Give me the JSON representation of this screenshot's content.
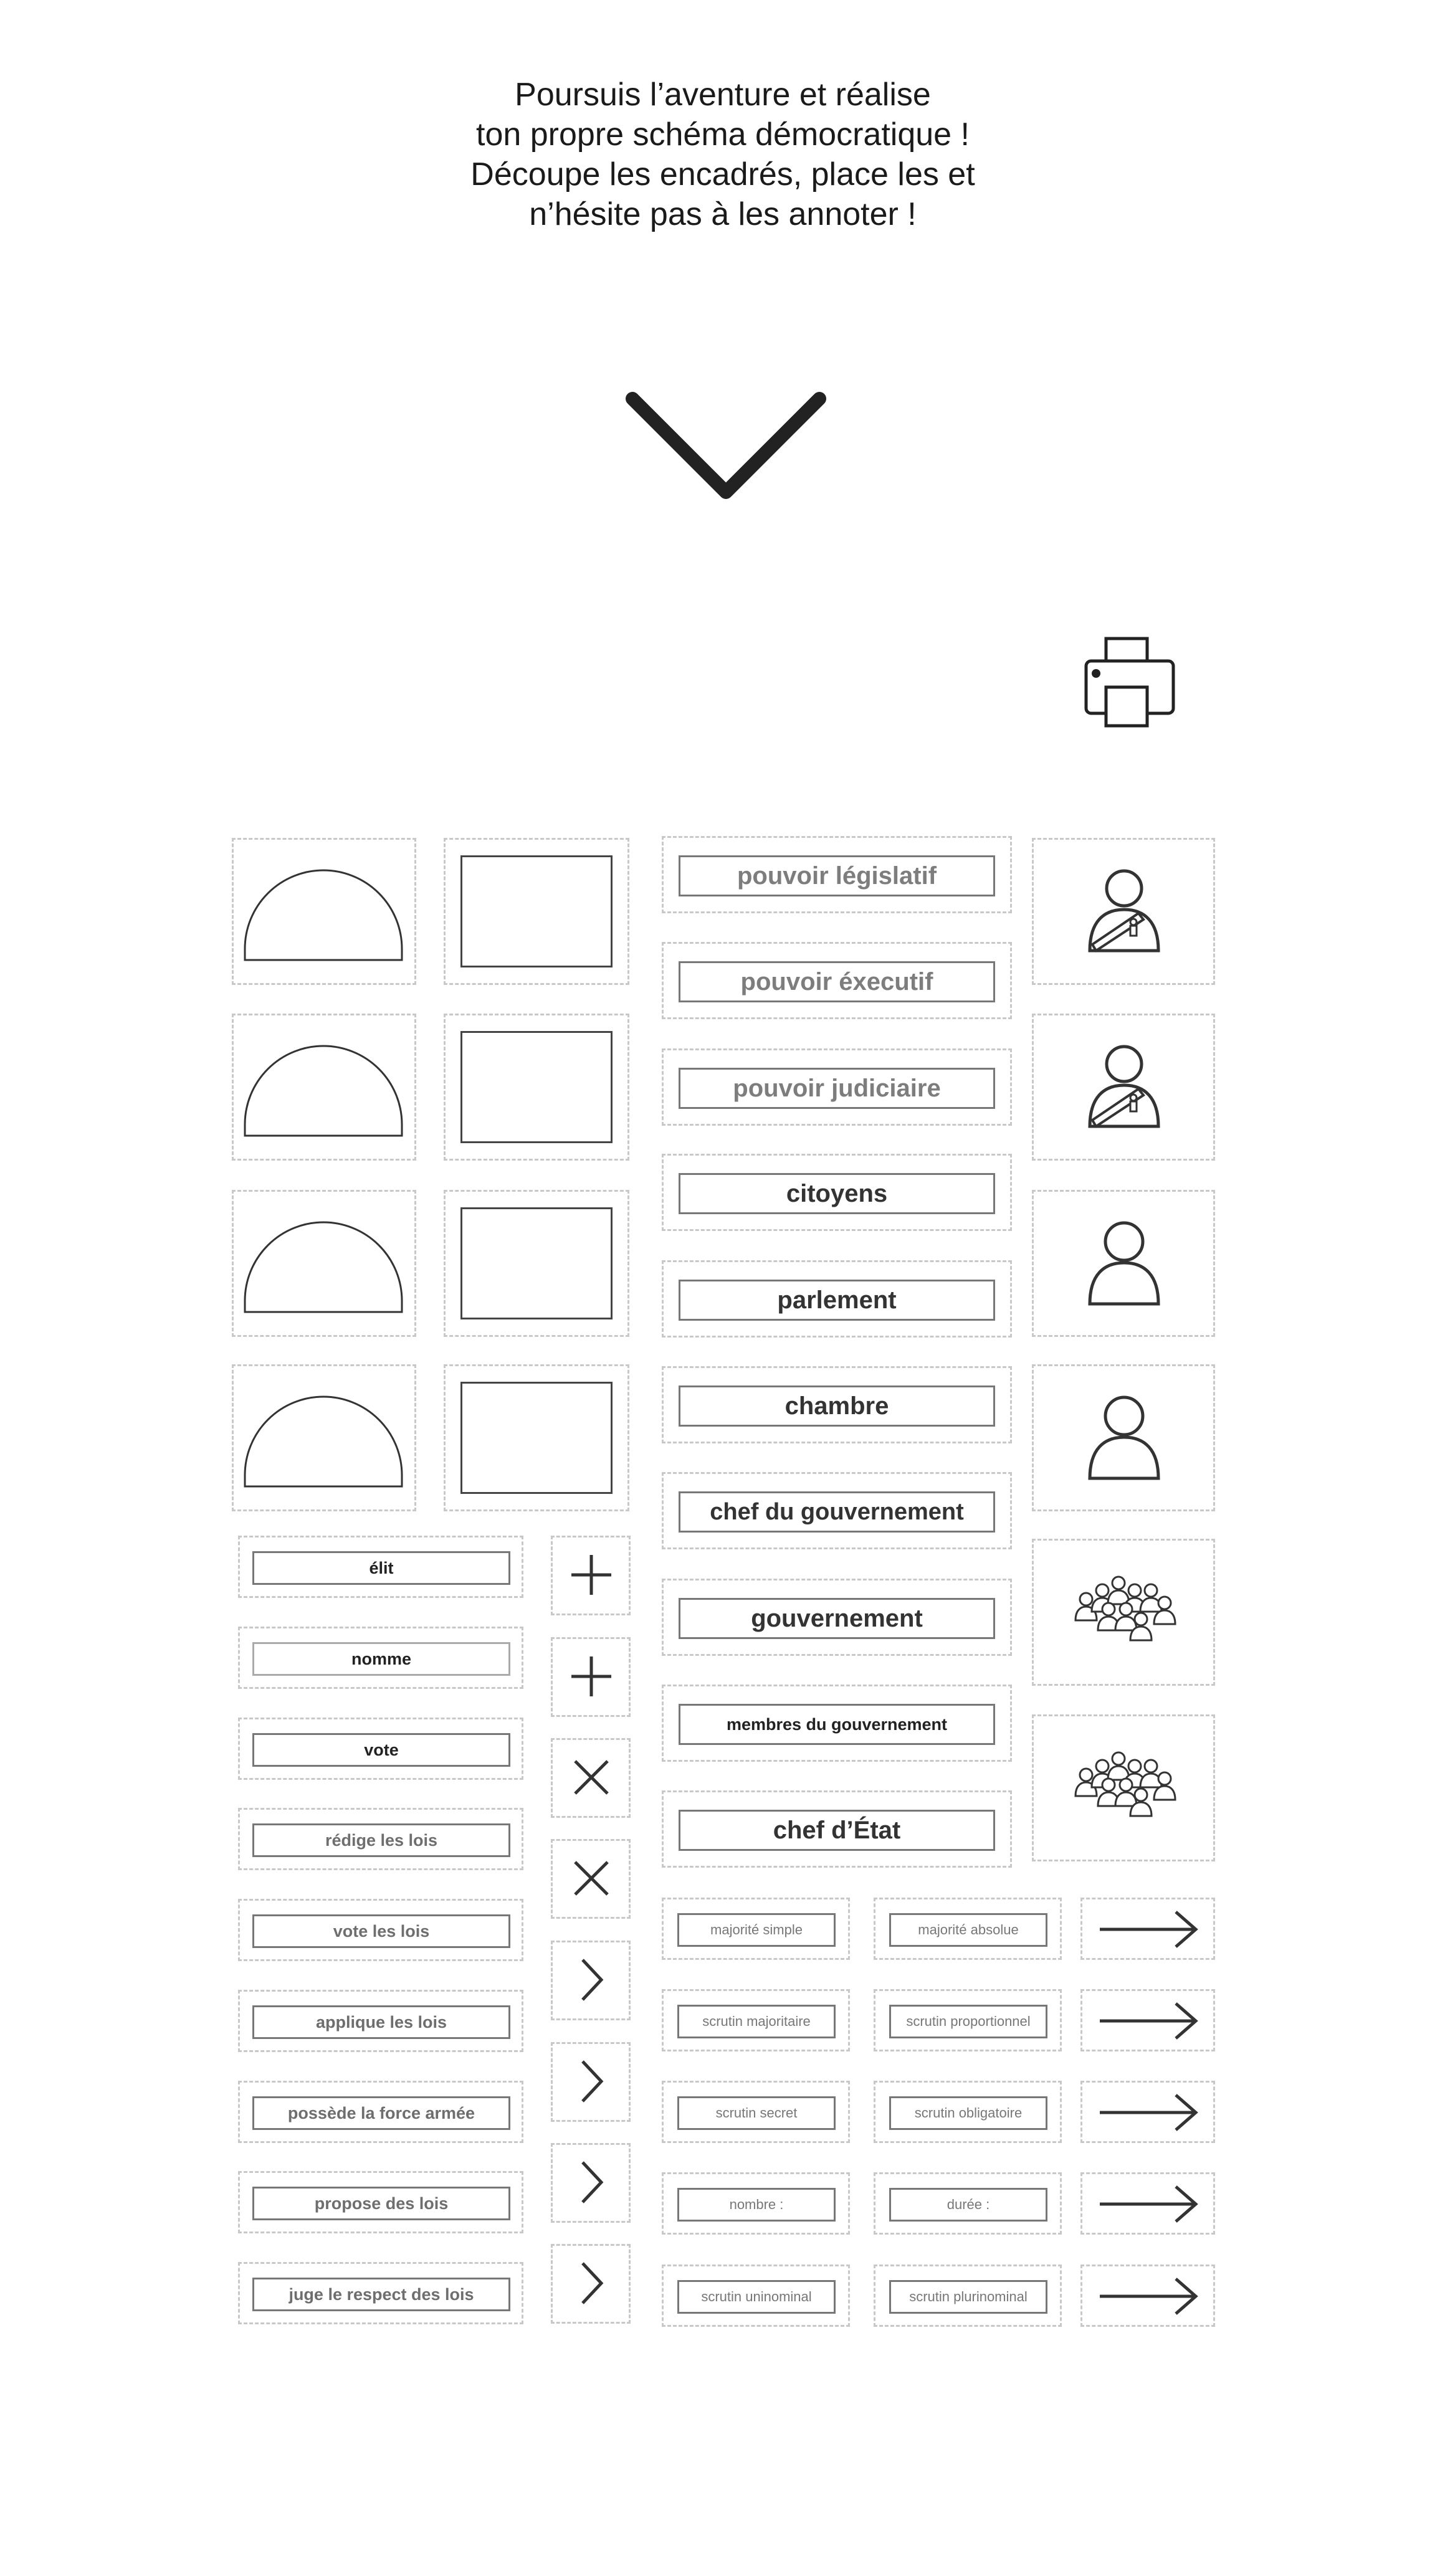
{
  "intro": {
    "lines": [
      "Poursuis l’aventure et réalise",
      "ton propre schéma démocratique !",
      "Découpe les encadrés, place les et",
      "n’hésite pas à les annoter !"
    ]
  },
  "icons": {
    "scroll": "chevron-down-icon",
    "print": "printer-icon",
    "hemicycle": "hemicycle-icon",
    "empty_box": "empty-frame",
    "head_of_state": "person-with-sash-icon",
    "person": "person-icon",
    "group": "people-group-icon",
    "plus": "plus-icon",
    "times": "times-icon",
    "chevron": "chevron-right-icon",
    "arrow": "arrow-right-icon"
  },
  "institutions": [
    "pouvoir législatif",
    "pouvoir éxecutif",
    "pouvoir judiciaire",
    "citoyens",
    "parlement",
    "chambre",
    "chef du gouvernement",
    "gouvernement",
    "membres du gouvernement",
    "chef d’État"
  ],
  "actions": [
    "élit",
    "nomme",
    "vote",
    "rédige les lois",
    "vote les lois",
    "applique les lois",
    "possède la force armée",
    "propose des lois",
    "juge le respect des lois"
  ],
  "modes": [
    [
      "majorité simple",
      "majorité absolue"
    ],
    [
      "scrutin majoritaire",
      "scrutin proportionnel"
    ],
    [
      "scrutin secret",
      "scrutin obligatoire"
    ],
    [
      "nombre :",
      "durée :"
    ],
    [
      "scrutin uninominal",
      "scrutin plurinominal"
    ]
  ],
  "colors": {
    "ink": "#222222",
    "cut_line": "#c8c8c8",
    "label_border": "#777777",
    "grey_text": "#7d7d7d"
  }
}
